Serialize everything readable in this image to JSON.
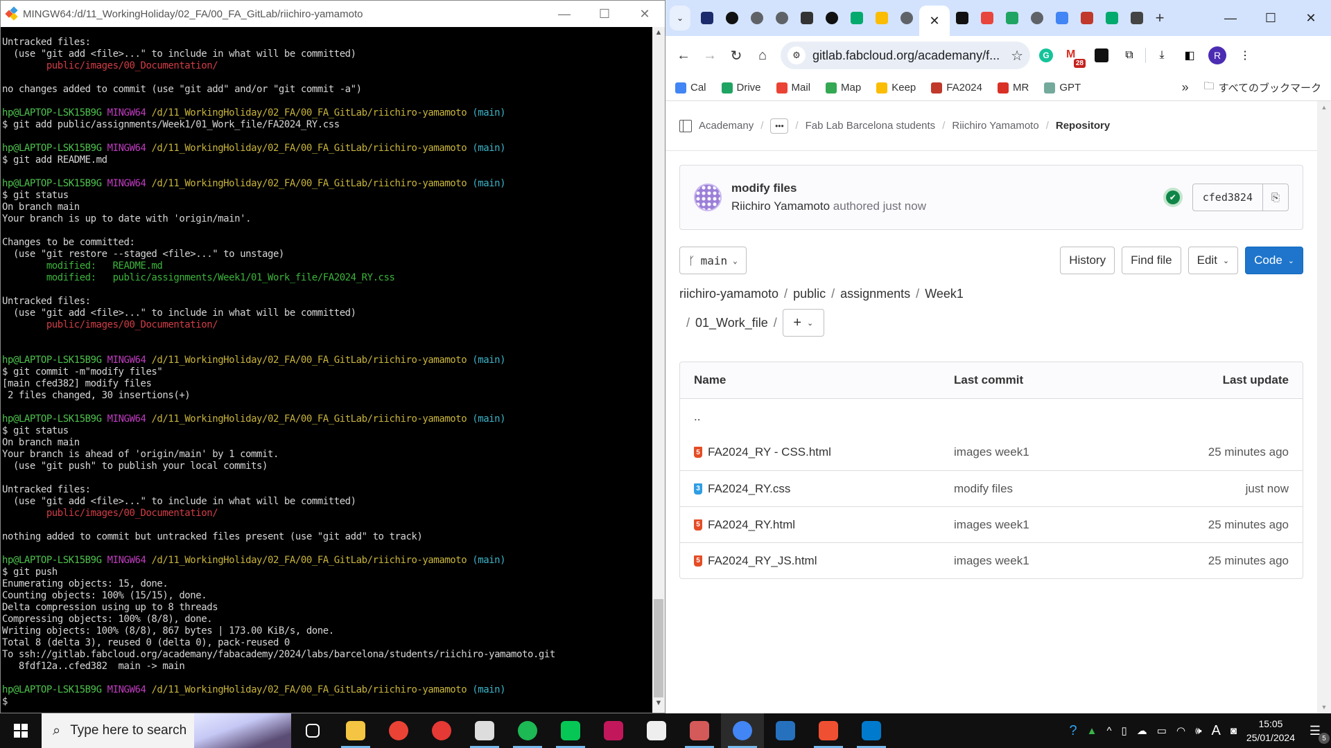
{
  "terminal": {
    "title": "MINGW64:/d/11_WorkingHoliday/02_FA/00_FA_GitLab/riichiro-yamamoto",
    "prompt": {
      "user_host": "hp@LAPTOP-LSK15B9G",
      "shell": "MINGW64",
      "path": "/d/11_WorkingHoliday/02_FA/00_FA_GitLab/riichiro-yamamoto",
      "branch": "(main)"
    },
    "lines": [
      {
        "type": "text",
        "text": "Untracked files:"
      },
      {
        "type": "text",
        "text": "  (use \"git add <file>...\" to include in what will be committed)"
      },
      {
        "type": "untracked",
        "text": "        public/images/00_Documentation/"
      },
      {
        "type": "blank",
        "text": ""
      },
      {
        "type": "text",
        "text": "no changes added to commit (use \"git add\" and/or \"git commit -a\")"
      },
      {
        "type": "blank",
        "text": ""
      },
      {
        "type": "prompt",
        "text": ""
      },
      {
        "type": "text",
        "text": "$ git add public/assignments/Week1/01_Work_file/FA2024_RY.css"
      },
      {
        "type": "blank",
        "text": ""
      },
      {
        "type": "prompt",
        "text": ""
      },
      {
        "type": "text",
        "text": "$ git add README.md"
      },
      {
        "type": "blank",
        "text": ""
      },
      {
        "type": "prompt",
        "text": ""
      },
      {
        "type": "text",
        "text": "$ git status"
      },
      {
        "type": "text",
        "text": "On branch main"
      },
      {
        "type": "text",
        "text": "Your branch is up to date with 'origin/main'."
      },
      {
        "type": "blank",
        "text": ""
      },
      {
        "type": "text",
        "text": "Changes to be committed:"
      },
      {
        "type": "text",
        "text": "  (use \"git restore --staged <file>...\" to unstage)"
      },
      {
        "type": "staged",
        "text": "        modified:   README.md"
      },
      {
        "type": "staged",
        "text": "        modified:   public/assignments/Week1/01_Work_file/FA2024_RY.css"
      },
      {
        "type": "blank",
        "text": ""
      },
      {
        "type": "text",
        "text": "Untracked files:"
      },
      {
        "type": "text",
        "text": "  (use \"git add <file>...\" to include in what will be committed)"
      },
      {
        "type": "untracked",
        "text": "        public/images/00_Documentation/"
      },
      {
        "type": "blank",
        "text": ""
      },
      {
        "type": "blank",
        "text": ""
      },
      {
        "type": "prompt",
        "text": ""
      },
      {
        "type": "text",
        "text": "$ git commit -m\"modify files\""
      },
      {
        "type": "text",
        "text": "[main cfed382] modify files"
      },
      {
        "type": "text",
        "text": " 2 files changed, 30 insertions(+)"
      },
      {
        "type": "blank",
        "text": ""
      },
      {
        "type": "prompt",
        "text": ""
      },
      {
        "type": "text",
        "text": "$ git status"
      },
      {
        "type": "text",
        "text": "On branch main"
      },
      {
        "type": "text",
        "text": "Your branch is ahead of 'origin/main' by 1 commit."
      },
      {
        "type": "text",
        "text": "  (use \"git push\" to publish your local commits)"
      },
      {
        "type": "blank",
        "text": ""
      },
      {
        "type": "text",
        "text": "Untracked files:"
      },
      {
        "type": "text",
        "text": "  (use \"git add <file>...\" to include in what will be committed)"
      },
      {
        "type": "untracked",
        "text": "        public/images/00_Documentation/"
      },
      {
        "type": "blank",
        "text": ""
      },
      {
        "type": "text",
        "text": "nothing added to commit but untracked files present (use \"git add\" to track)"
      },
      {
        "type": "blank",
        "text": ""
      },
      {
        "type": "prompt",
        "text": ""
      },
      {
        "type": "text",
        "text": "$ git push"
      },
      {
        "type": "text",
        "text": "Enumerating objects: 15, done."
      },
      {
        "type": "text",
        "text": "Counting objects: 100% (15/15), done."
      },
      {
        "type": "text",
        "text": "Delta compression using up to 8 threads"
      },
      {
        "type": "text",
        "text": "Compressing objects: 100% (8/8), done."
      },
      {
        "type": "text",
        "text": "Writing objects: 100% (8/8), 867 bytes | 173.00 KiB/s, done."
      },
      {
        "type": "text",
        "text": "Total 8 (delta 3), reused 0 (delta 0), pack-reused 0"
      },
      {
        "type": "text",
        "text": "To ssh://gitlab.fabcloud.org/academany/fabacademy/2024/labs/barcelona/students/riichiro-yamamoto.git"
      },
      {
        "type": "text",
        "text": "   8fdf12a..cfed382  main -> main"
      },
      {
        "type": "blank",
        "text": ""
      },
      {
        "type": "prompt",
        "text": ""
      },
      {
        "type": "text",
        "text": "$ "
      }
    ],
    "window_controls": {
      "minimize": "—",
      "maximize": "☐",
      "close": "✕"
    }
  },
  "browser": {
    "tab_list_glyph": "⌄",
    "active_tab_close": "✕",
    "tab_favicons": [
      {
        "name": "fabapps",
        "color": "#1a2a6c"
      },
      {
        "name": "fablab-tv",
        "color": "#111111"
      },
      {
        "name": "globe",
        "color": "#5f6368"
      },
      {
        "name": "globe",
        "color": "#5f6368"
      },
      {
        "name": "book",
        "color": "#333333"
      },
      {
        "name": "fablab-tv",
        "color": "#111111"
      },
      {
        "name": "w3schools",
        "color": "#04aa6d"
      },
      {
        "name": "keep",
        "color": "#fbbc04"
      },
      {
        "name": "globe",
        "color": "#5f6368"
      }
    ],
    "tab_favicons_after": [
      {
        "name": "fablab-bcn",
        "color": "#111111"
      },
      {
        "name": "slack-like",
        "color": "#e8453c"
      },
      {
        "name": "drive",
        "color": "#1fa463"
      },
      {
        "name": "globe",
        "color": "#5f6368"
      },
      {
        "name": "calendar",
        "color": "#4285f4"
      },
      {
        "name": "fabacademy",
        "color": "#c0392b"
      },
      {
        "name": "w3schools",
        "color": "#04aa6d"
      },
      {
        "name": "panda",
        "color": "#444444"
      }
    ],
    "new_tab": "+",
    "window_controls": {
      "minimize": "—",
      "maximize": "☐",
      "close": "✕"
    },
    "url": "gitlab.fabcloud.org/academany/f...",
    "extensions": {
      "grammarly": "G",
      "gmail_badge": "28",
      "profile_initial": "R"
    },
    "bookmarks": [
      {
        "label": "Cal",
        "color": "#4285f4"
      },
      {
        "label": "Drive",
        "color": "#1fa463"
      },
      {
        "label": "Mail",
        "color": "#ea4335"
      },
      {
        "label": "Map",
        "color": "#34a853"
      },
      {
        "label": "Keep",
        "color": "#fbbc04"
      },
      {
        "label": "FA2024",
        "color": "#c0392b"
      },
      {
        "label": "MR",
        "color": "#d93025"
      },
      {
        "label": "GPT",
        "color": "#74aa9c"
      }
    ],
    "bookmarks_more": "»",
    "all_bookmarks": "すべてのブックマーク"
  },
  "gitlab": {
    "breadcrumbs": [
      "Academany",
      "Fab Lab Barcelona students",
      "Riichiro Yamamoto"
    ],
    "breadcrumb_current": "Repository",
    "commit": {
      "title": "modify files",
      "author": "Riichiro Yamamoto",
      "authored": "authored just now",
      "sha": "cfed3824",
      "pipeline_status": "passed"
    },
    "branch": "main",
    "buttons": {
      "history": "History",
      "find_file": "Find file",
      "edit": "Edit",
      "code": "Code"
    },
    "path": [
      "riichiro-yamamoto",
      "public",
      "assignments",
      "Week1"
    ],
    "path_tail": "01_Work_file",
    "table": {
      "headers": {
        "name": "Name",
        "last_commit": "Last commit",
        "last_update": "Last update"
      },
      "parent": "..",
      "rows": [
        {
          "name": "FA2024_RY - CSS.html",
          "type": "html",
          "commit": "images week1",
          "updated": "25 minutes ago"
        },
        {
          "name": "FA2024_RY.css",
          "type": "css",
          "commit": "modify files",
          "updated": "just now"
        },
        {
          "name": "FA2024_RY.html",
          "type": "html",
          "commit": "images week1",
          "updated": "25 minutes ago"
        },
        {
          "name": "FA2024_RY_JS.html",
          "type": "html",
          "commit": "images week1",
          "updated": "25 minutes ago"
        }
      ]
    }
  },
  "taskbar": {
    "search_placeholder": "Type here to search",
    "apps": [
      {
        "name": "task-view",
        "color": "#101010",
        "running": false
      },
      {
        "name": "file-explorer",
        "color": "#f4c542",
        "running": true
      },
      {
        "name": "google-photos",
        "color": "#ea4335",
        "running": false
      },
      {
        "name": "voice-recorder",
        "color": "#e53935",
        "running": false
      },
      {
        "name": "settings",
        "color": "#dddddd",
        "running": true
      },
      {
        "name": "spotify",
        "color": "#1db954",
        "running": true
      },
      {
        "name": "line",
        "color": "#06c755",
        "running": true
      },
      {
        "name": "affinity-publisher",
        "color": "#c2185b",
        "running": false
      },
      {
        "name": "inkscape",
        "color": "#eeeeee",
        "running": false
      },
      {
        "name": "snipping-tool",
        "color": "#d45a5a",
        "running": true
      },
      {
        "name": "chrome",
        "color": "#4285f4",
        "running": true,
        "active": true
      },
      {
        "name": "powershell",
        "color": "#2671be",
        "running": false
      },
      {
        "name": "git-gui",
        "color": "#f05032",
        "running": true
      },
      {
        "name": "vscode",
        "color": "#007acc",
        "running": true
      }
    ],
    "tray": {
      "ime": "A",
      "time": "15:05",
      "date": "25/01/2024",
      "notifications": "5"
    }
  }
}
